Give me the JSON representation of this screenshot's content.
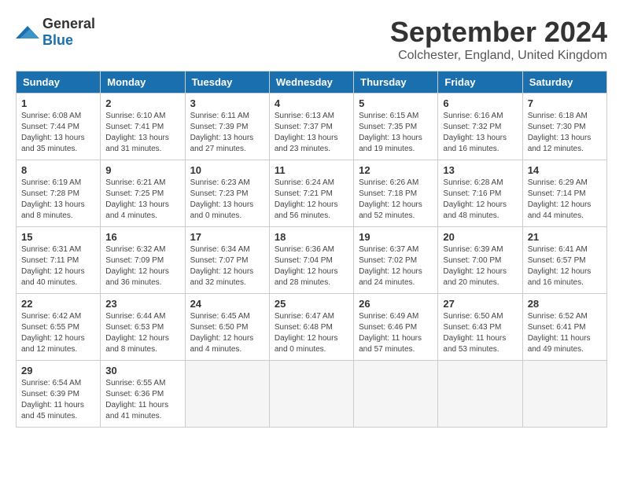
{
  "logo": {
    "general": "General",
    "blue": "Blue"
  },
  "title": "September 2024",
  "location": "Colchester, England, United Kingdom",
  "headers": [
    "Sunday",
    "Monday",
    "Tuesday",
    "Wednesday",
    "Thursday",
    "Friday",
    "Saturday"
  ],
  "weeks": [
    [
      {
        "day": "1",
        "info": "Sunrise: 6:08 AM\nSunset: 7:44 PM\nDaylight: 13 hours\nand 35 minutes."
      },
      {
        "day": "2",
        "info": "Sunrise: 6:10 AM\nSunset: 7:41 PM\nDaylight: 13 hours\nand 31 minutes."
      },
      {
        "day": "3",
        "info": "Sunrise: 6:11 AM\nSunset: 7:39 PM\nDaylight: 13 hours\nand 27 minutes."
      },
      {
        "day": "4",
        "info": "Sunrise: 6:13 AM\nSunset: 7:37 PM\nDaylight: 13 hours\nand 23 minutes."
      },
      {
        "day": "5",
        "info": "Sunrise: 6:15 AM\nSunset: 7:35 PM\nDaylight: 13 hours\nand 19 minutes."
      },
      {
        "day": "6",
        "info": "Sunrise: 6:16 AM\nSunset: 7:32 PM\nDaylight: 13 hours\nand 16 minutes."
      },
      {
        "day": "7",
        "info": "Sunrise: 6:18 AM\nSunset: 7:30 PM\nDaylight: 13 hours\nand 12 minutes."
      }
    ],
    [
      {
        "day": "8",
        "info": "Sunrise: 6:19 AM\nSunset: 7:28 PM\nDaylight: 13 hours\nand 8 minutes."
      },
      {
        "day": "9",
        "info": "Sunrise: 6:21 AM\nSunset: 7:25 PM\nDaylight: 13 hours\nand 4 minutes."
      },
      {
        "day": "10",
        "info": "Sunrise: 6:23 AM\nSunset: 7:23 PM\nDaylight: 13 hours\nand 0 minutes."
      },
      {
        "day": "11",
        "info": "Sunrise: 6:24 AM\nSunset: 7:21 PM\nDaylight: 12 hours\nand 56 minutes."
      },
      {
        "day": "12",
        "info": "Sunrise: 6:26 AM\nSunset: 7:18 PM\nDaylight: 12 hours\nand 52 minutes."
      },
      {
        "day": "13",
        "info": "Sunrise: 6:28 AM\nSunset: 7:16 PM\nDaylight: 12 hours\nand 48 minutes."
      },
      {
        "day": "14",
        "info": "Sunrise: 6:29 AM\nSunset: 7:14 PM\nDaylight: 12 hours\nand 44 minutes."
      }
    ],
    [
      {
        "day": "15",
        "info": "Sunrise: 6:31 AM\nSunset: 7:11 PM\nDaylight: 12 hours\nand 40 minutes."
      },
      {
        "day": "16",
        "info": "Sunrise: 6:32 AM\nSunset: 7:09 PM\nDaylight: 12 hours\nand 36 minutes."
      },
      {
        "day": "17",
        "info": "Sunrise: 6:34 AM\nSunset: 7:07 PM\nDaylight: 12 hours\nand 32 minutes."
      },
      {
        "day": "18",
        "info": "Sunrise: 6:36 AM\nSunset: 7:04 PM\nDaylight: 12 hours\nand 28 minutes."
      },
      {
        "day": "19",
        "info": "Sunrise: 6:37 AM\nSunset: 7:02 PM\nDaylight: 12 hours\nand 24 minutes."
      },
      {
        "day": "20",
        "info": "Sunrise: 6:39 AM\nSunset: 7:00 PM\nDaylight: 12 hours\nand 20 minutes."
      },
      {
        "day": "21",
        "info": "Sunrise: 6:41 AM\nSunset: 6:57 PM\nDaylight: 12 hours\nand 16 minutes."
      }
    ],
    [
      {
        "day": "22",
        "info": "Sunrise: 6:42 AM\nSunset: 6:55 PM\nDaylight: 12 hours\nand 12 minutes."
      },
      {
        "day": "23",
        "info": "Sunrise: 6:44 AM\nSunset: 6:53 PM\nDaylight: 12 hours\nand 8 minutes."
      },
      {
        "day": "24",
        "info": "Sunrise: 6:45 AM\nSunset: 6:50 PM\nDaylight: 12 hours\nand 4 minutes."
      },
      {
        "day": "25",
        "info": "Sunrise: 6:47 AM\nSunset: 6:48 PM\nDaylight: 12 hours\nand 0 minutes."
      },
      {
        "day": "26",
        "info": "Sunrise: 6:49 AM\nSunset: 6:46 PM\nDaylight: 11 hours\nand 57 minutes."
      },
      {
        "day": "27",
        "info": "Sunrise: 6:50 AM\nSunset: 6:43 PM\nDaylight: 11 hours\nand 53 minutes."
      },
      {
        "day": "28",
        "info": "Sunrise: 6:52 AM\nSunset: 6:41 PM\nDaylight: 11 hours\nand 49 minutes."
      }
    ],
    [
      {
        "day": "29",
        "info": "Sunrise: 6:54 AM\nSunset: 6:39 PM\nDaylight: 11 hours\nand 45 minutes."
      },
      {
        "day": "30",
        "info": "Sunrise: 6:55 AM\nSunset: 6:36 PM\nDaylight: 11 hours\nand 41 minutes."
      },
      {
        "day": "",
        "info": ""
      },
      {
        "day": "",
        "info": ""
      },
      {
        "day": "",
        "info": ""
      },
      {
        "day": "",
        "info": ""
      },
      {
        "day": "",
        "info": ""
      }
    ]
  ]
}
